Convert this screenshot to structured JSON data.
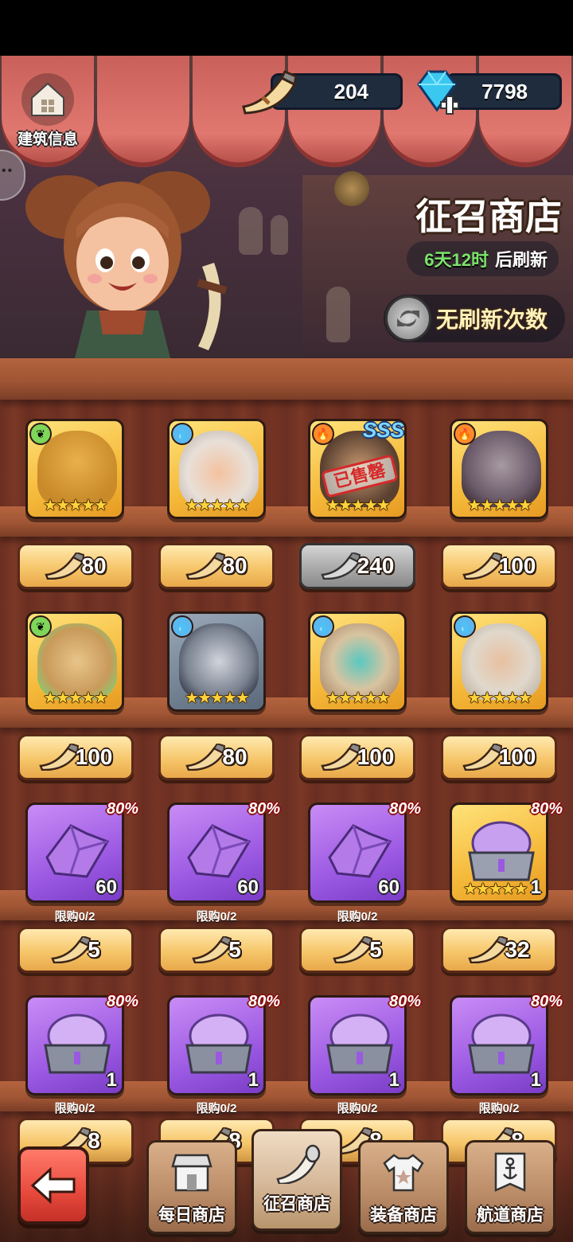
{
  "header": {
    "building_info_label": "建筑信息",
    "horn_currency": "204",
    "gem_currency": "7798"
  },
  "shop": {
    "title": "征召商店",
    "refresh_time": "6天12时",
    "refresh_suffix": "后刷新",
    "no_refresh_label": "无刷新次数"
  },
  "colors": {
    "price_gold": "#f6c66a",
    "price_grey": "#a6a6a6",
    "card_gold": "#f5b93a",
    "card_purple": "#9c5ae3",
    "refresh_green": "#7be36a"
  },
  "items": [
    {
      "element": "leaf-icon",
      "stars": "★★★★★",
      "price": "80",
      "sold": false
    },
    {
      "element": "water-icon",
      "stars": "★★★★★",
      "price": "80",
      "sold": false
    },
    {
      "element": "fire-icon",
      "stars": "★★★★★",
      "price": "240",
      "sold": true,
      "rank": "SSS",
      "sold_label": "已售罄"
    },
    {
      "element": "fire-icon",
      "stars": "★★★★★",
      "price": "100",
      "sold": false
    },
    {
      "element": "leaf-icon",
      "stars": "★★★★★",
      "price": "100",
      "sold": false
    },
    {
      "element": "water-icon",
      "stars": "★★★★★",
      "price": "80",
      "sold": false
    },
    {
      "element": "water-icon",
      "stars": "★★★★★",
      "price": "100",
      "sold": false
    },
    {
      "element": "water-icon",
      "stars": "★★★★★",
      "price": "100",
      "sold": false
    },
    {
      "type": "shard",
      "discount": "80%",
      "qty": "60",
      "limit": "限购0/2",
      "price": "5"
    },
    {
      "type": "shard",
      "discount": "80%",
      "qty": "60",
      "limit": "限购0/2",
      "price": "5"
    },
    {
      "type": "shard",
      "discount": "80%",
      "qty": "60",
      "limit": "限购0/2",
      "price": "5"
    },
    {
      "type": "gold-chest",
      "discount": "80%",
      "qty": "1",
      "stars": "★★★★★",
      "price": "32"
    },
    {
      "type": "chest",
      "discount": "80%",
      "qty": "1",
      "limit": "限购0/2",
      "price": "8"
    },
    {
      "type": "chest",
      "discount": "80%",
      "qty": "1",
      "limit": "限购0/2",
      "price": "8"
    },
    {
      "type": "chest",
      "discount": "80%",
      "qty": "1",
      "limit": "限购0/2",
      "price": "8"
    },
    {
      "type": "chest",
      "discount": "80%",
      "qty": "1",
      "limit": "限购0/2",
      "price": "8"
    }
  ],
  "nav": {
    "daily": "每日商店",
    "recruit": "征召商店",
    "equipment": "装备商店",
    "voyage": "航道商店"
  }
}
